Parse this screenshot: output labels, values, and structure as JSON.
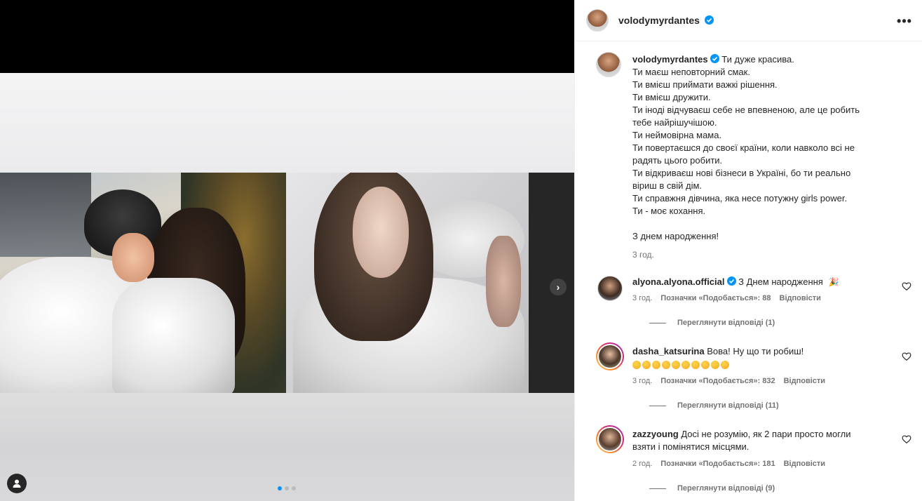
{
  "post": {
    "author": "volodymyrdantes",
    "caption_lines": [
      "Ти дуже красива.",
      "Ти маєш неповторний смак.",
      "Ти вмієш приймати важкі рішення.",
      "Ти вмієш дружити.",
      "Ти іноді відчуваєш себе не впевненою, але це робить",
      "тебе найрішучішою.",
      "Ти неймовірна мама.",
      "Ти повертаєшся до своєї країни, коли навколо всі не",
      "радять цього робити.",
      "Ти відкриваєш нові бізнеси в Україні, бо ти реально",
      "віриш в свій дім.",
      "Ти справжня дівчина, яка несе потужну girls power.",
      "Ти - моє кохання.",
      "",
      "З днем народження!"
    ],
    "time": "3 год.",
    "carousel": {
      "slide_count": 3,
      "active_index": 0
    }
  },
  "icons": {
    "verified": "verified-badge-icon",
    "more": "more-options-icon",
    "next": "chevron-right-icon",
    "user_tag": "user-tag-icon",
    "heart": "heart-icon",
    "emoji": "crying-face-emoji"
  },
  "colors": {
    "verified": "#0095f6",
    "text": "#262626",
    "muted": "#737373",
    "active_dot": "#0095f6"
  },
  "comments": [
    {
      "user": "alyona.alyona.official",
      "verified": true,
      "text": "З Днем народження",
      "emoji": "🎉",
      "time": "3 год.",
      "likes": "Позначки «Подобається»: 88",
      "reply": "Відповісти",
      "view_replies": "Переглянути відповіді (1)"
    },
    {
      "user": "dasha_katsurina",
      "verified": false,
      "text": "Вова! Ну що ти робиш!",
      "emoji_count": 10,
      "time": "3 год.",
      "likes": "Позначки «Подобається»: 832",
      "reply": "Відповісти",
      "view_replies": "Переглянути відповіді (11)"
    },
    {
      "user": "zazzyoung",
      "verified": false,
      "text_line1": "Досі не розумію, як 2 пари просто могли",
      "text_line2": "взяти і помінятися місцями.",
      "time": "2 год.",
      "likes": "Позначки «Подобається»: 181",
      "reply": "Відповісти",
      "view_replies": "Переглянути відповіді (9)"
    }
  ]
}
